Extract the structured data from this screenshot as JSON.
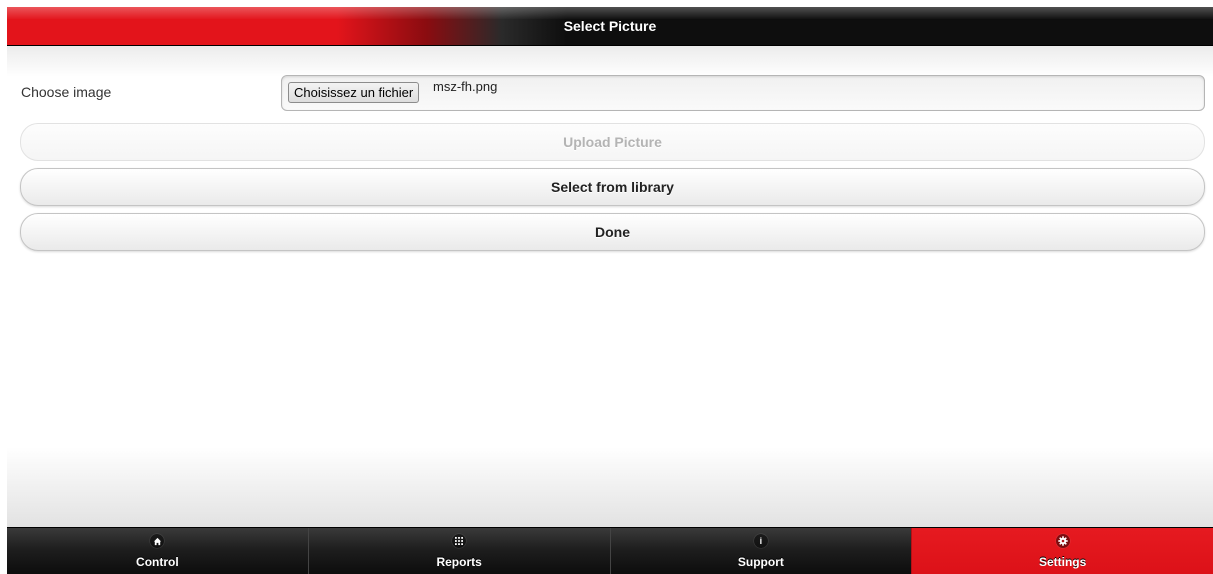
{
  "header": {
    "title": "Select Picture"
  },
  "form": {
    "choose_label": "Choose image",
    "file_button_label": "Choisissez un fichier",
    "file_name": "msz-fh.png"
  },
  "buttons": {
    "upload": "Upload Picture",
    "library": "Select from library",
    "done": "Done"
  },
  "tabs": [
    {
      "label": "Control",
      "icon": "home-icon"
    },
    {
      "label": "Reports",
      "icon": "grid-icon"
    },
    {
      "label": "Support",
      "icon": "info-icon"
    },
    {
      "label": "Settings",
      "icon": "gear-icon",
      "active": true
    }
  ],
  "colors": {
    "accent": "#e3141b",
    "header_dark": "#0e0e0e"
  }
}
